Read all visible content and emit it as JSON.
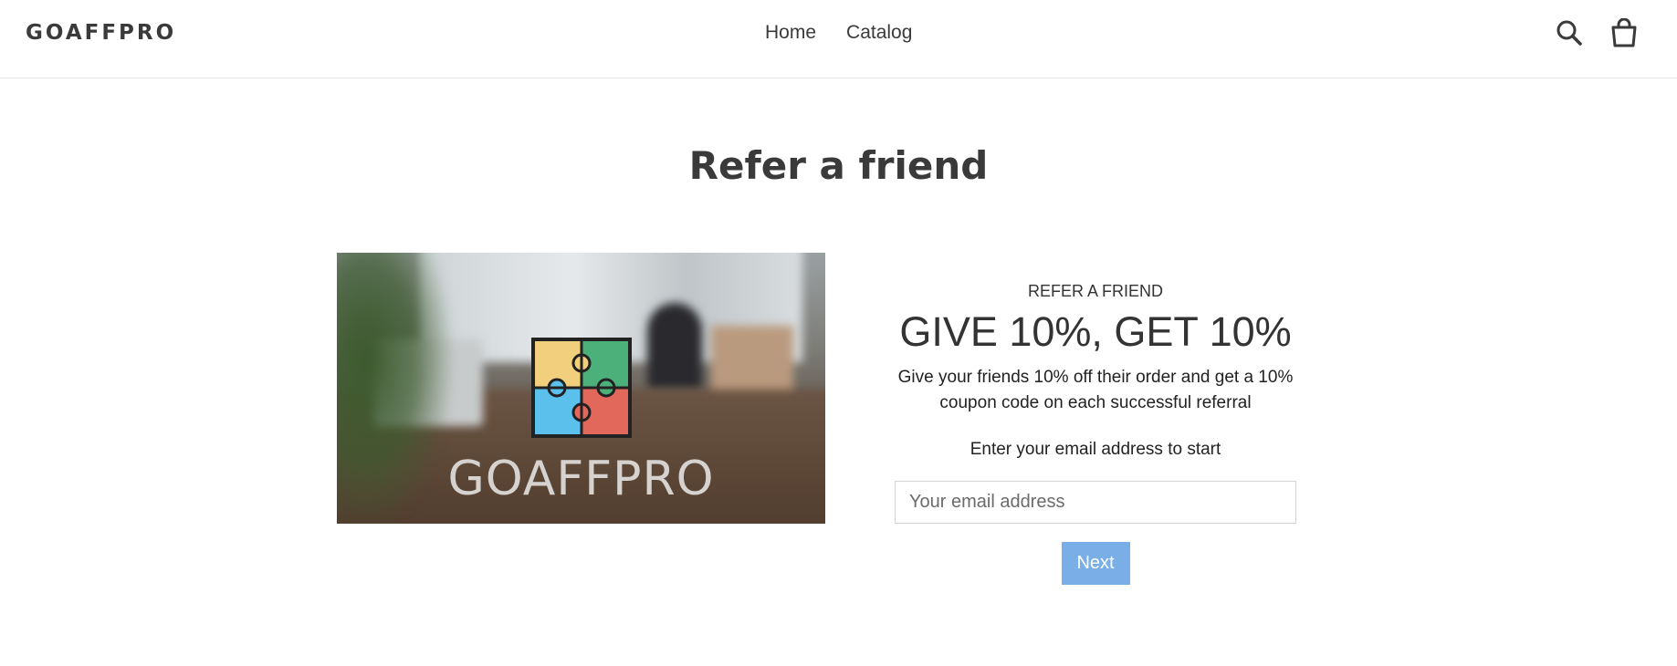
{
  "header": {
    "logo": "GOAFFPRO",
    "nav": [
      {
        "label": "Home"
      },
      {
        "label": "Catalog"
      }
    ],
    "icons": [
      "search-icon",
      "cart-icon"
    ]
  },
  "page": {
    "title": "Refer a friend"
  },
  "hero": {
    "brand_text": "GOAFFPRO",
    "icon": "puzzle-icon",
    "puzzle_colors": [
      "#f2cf7c",
      "#4bb07a",
      "#5bc0ec",
      "#e2685c"
    ]
  },
  "referral": {
    "kicker": "REFER A FRIEND",
    "headline": "GIVE 10%, GET 10%",
    "description": "Give your friends 10% off their order and get a 10% coupon code on each successful referral",
    "prompt": "Enter your email address to start",
    "email_placeholder": "Your email address",
    "next_label": "Next",
    "button_color": "#79aee6"
  }
}
